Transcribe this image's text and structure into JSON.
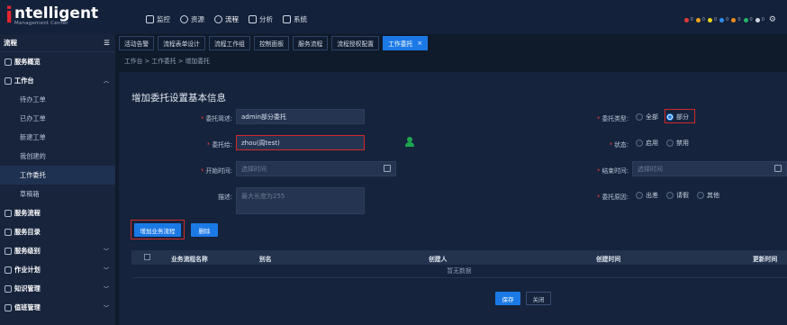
{
  "app": {
    "logo_main": "ntelligent",
    "logo_sub": "Management Center"
  },
  "top_menu": [
    {
      "label": "监控",
      "icon": "monitor-icon"
    },
    {
      "label": "资源",
      "icon": "resource-icon"
    },
    {
      "label": "流程",
      "icon": "process-icon"
    },
    {
      "label": "分析",
      "icon": "analysis-icon"
    },
    {
      "label": "系统",
      "icon": "system-icon"
    }
  ],
  "status_counts": [
    {
      "color": "#e03a3a",
      "count": "0"
    },
    {
      "color": "#f2a51a",
      "count": "0"
    },
    {
      "color": "#e9d51c",
      "count": "0"
    },
    {
      "color": "#2d8ef0",
      "count": "0"
    },
    {
      "color": "#f08a1a",
      "count": "0"
    },
    {
      "color": "#26b36b",
      "count": "0"
    },
    {
      "color": "#cfd6e0",
      "count": "0"
    }
  ],
  "sidebar": {
    "header": "流程",
    "items": [
      {
        "label": "服务概览",
        "icon": "home-icon"
      },
      {
        "label": "工作台",
        "icon": "desk-icon"
      },
      {
        "label": "待办工单"
      },
      {
        "label": "已办工单"
      },
      {
        "label": "新建工单"
      },
      {
        "label": "我创建的"
      },
      {
        "label": "工作委托"
      },
      {
        "label": "草稿箱"
      },
      {
        "label": "服务流程",
        "icon": "flow-icon"
      },
      {
        "label": "服务目录",
        "icon": "catalog-icon"
      },
      {
        "label": "服务级别",
        "icon": "sla-icon"
      },
      {
        "label": "作业计划",
        "icon": "plan-icon"
      },
      {
        "label": "知识管理",
        "icon": "knowledge-icon"
      },
      {
        "label": "值班管理",
        "icon": "duty-icon"
      }
    ]
  },
  "tabs": [
    {
      "label": "活动告警"
    },
    {
      "label": "流程表单设计"
    },
    {
      "label": "流程工作组"
    },
    {
      "label": "控制面板"
    },
    {
      "label": "服务流程"
    },
    {
      "label": "流程授权配置"
    },
    {
      "label": "工作委托"
    }
  ],
  "breadcrumb": "工作台 > 工作委托 > 增加委托",
  "form": {
    "title": "增加委托设置基本信息",
    "desc_label": "委托简述:",
    "desc_value": "admin部分委托",
    "type_label": "委托类型:",
    "type_all": "全部",
    "type_part": "部分",
    "delegate_label": "委托给:",
    "delegate_value": "zhou(周test)",
    "status_label": "状态:",
    "status_on": "启用",
    "status_off": "禁用",
    "start_label": "开始时间:",
    "start_ph": "选择时间",
    "end_label": "结束时间:",
    "end_ph": "选择时间",
    "note_label": "描述:",
    "note_ph": "最大长度为255",
    "reason_label": "委托原因:",
    "reason_trip": "出差",
    "reason_leave": "请假",
    "reason_other": "其他"
  },
  "actions": {
    "add_flow": "增加业务流程",
    "delete": "删除",
    "save": "保存",
    "close": "关闭"
  },
  "table": {
    "headers": [
      "业务流程名称",
      "别名",
      "创建人",
      "创建时间",
      "更新时间"
    ],
    "empty": "暂无数据"
  }
}
